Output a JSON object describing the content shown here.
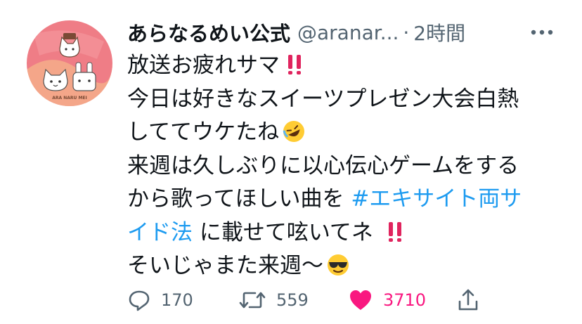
{
  "tweet": {
    "display_name": "あらなるめい公式",
    "handle": "@aranar...",
    "separator": "·",
    "time": "2時間",
    "avatar": {
      "caption": "ARA NARU MEI",
      "colors": {
        "background": "#ef7d86",
        "accent": "#f6b88a"
      }
    },
    "lines": [
      {
        "text": "放送お疲れサマ",
        "emoji": "double-exclamation-icon"
      },
      {
        "text": "今日は好きなスイーツプレゼン大会白熱"
      },
      {
        "text": "しててウケたね",
        "emoji": "rolling-laughing-emoji"
      },
      {
        "text": "来週は久しぶりに以心伝心ゲームをする"
      },
      {
        "before": "から歌ってほしい曲を ",
        "hashtag": "#エキサイト両サ"
      },
      {
        "hashtag_cont": "イド法",
        "after": " に載せて呟いてネ ",
        "emoji": "double-exclamation-icon"
      },
      {
        "text": "そいじゃまた来週〜",
        "emoji": "sunglasses-emoji"
      }
    ],
    "actions": {
      "reply": {
        "icon": "reply-icon",
        "count": "170"
      },
      "retweet": {
        "icon": "retweet-icon",
        "count": "559"
      },
      "like": {
        "icon": "heart-icon",
        "count": "3710",
        "color": "#f91880"
      },
      "share": {
        "icon": "share-icon"
      }
    },
    "colors": {
      "hashtag": "#1d9bf0",
      "secondary": "#536471",
      "exclamation": "#e0245e"
    }
  }
}
